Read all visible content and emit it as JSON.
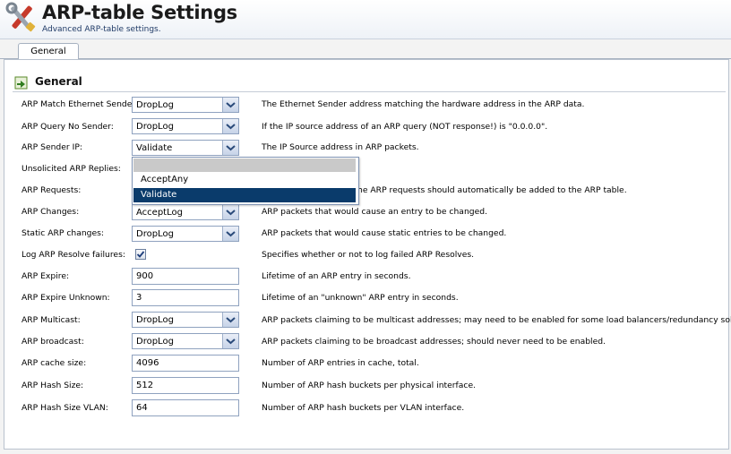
{
  "header": {
    "title": "ARP-table Settings",
    "subtitle": "Advanced ARP-table settings."
  },
  "tabs": [
    {
      "label": "General"
    }
  ],
  "section": {
    "title": "General"
  },
  "rows": [
    {
      "label": "ARP Match Ethernet Sender:",
      "control": "select",
      "value": "DropLog",
      "description": "The Ethernet Sender address matching the hardware address in the ARP data."
    },
    {
      "label": "ARP Query No Sender:",
      "control": "select",
      "value": "DropLog",
      "description": "If the IP source address of an ARP query (NOT response!) is \"0.0.0.0\"."
    },
    {
      "label": "ARP Sender IP:",
      "control": "select",
      "value": "Validate",
      "description": "The IP Source address in ARP packets."
    },
    {
      "label": "Unsolicited ARP Replies:",
      "control": "select",
      "value": "",
      "description": ""
    },
    {
      "label": "ARP Requests:",
      "control": "select",
      "value": "",
      "description": "he ARP requests should automatically be added to the ARP table."
    },
    {
      "label": "ARP Changes:",
      "control": "select",
      "value": "AcceptLog",
      "description": "ARP packets that would cause an entry to be changed."
    },
    {
      "label": "Static ARP changes:",
      "control": "select",
      "value": "DropLog",
      "description": "ARP packets that would cause static entries to be changed."
    },
    {
      "label": "Log ARP Resolve failures:",
      "control": "checkbox",
      "checked": true,
      "description": "Specifies whether or not to log failed ARP Resolves."
    },
    {
      "label": "ARP Expire:",
      "control": "input",
      "value": "900",
      "description": "Lifetime of an ARP entry in seconds."
    },
    {
      "label": "ARP Expire Unknown:",
      "control": "input",
      "value": "3",
      "description": "Lifetime of an \"unknown\" ARP entry in seconds."
    },
    {
      "label": "ARP Multicast:",
      "control": "select",
      "value": "DropLog",
      "description": "ARP packets claiming to be multicast addresses; may need to be enabled for some load balancers/redundancy solutions."
    },
    {
      "label": "ARP broadcast:",
      "control": "select",
      "value": "DropLog",
      "description": "ARP packets claiming to be broadcast addresses; should never need to be enabled."
    },
    {
      "label": "ARP cache size:",
      "control": "input",
      "value": "4096",
      "description": "Number of ARP entries in cache, total."
    },
    {
      "label": "ARP Hash Size:",
      "control": "input",
      "value": "512",
      "description": "Number of ARP hash buckets per physical interface."
    },
    {
      "label": "ARP Hash Size VLAN:",
      "control": "input",
      "value": "64",
      "description": "Number of ARP hash buckets per VLAN interface."
    }
  ],
  "dropdown_open": {
    "options": [
      "",
      "AcceptAny",
      "Validate"
    ],
    "selected": "Validate"
  },
  "colors": {
    "accent": "#0a3b6b",
    "border": "#8fa2bf"
  }
}
